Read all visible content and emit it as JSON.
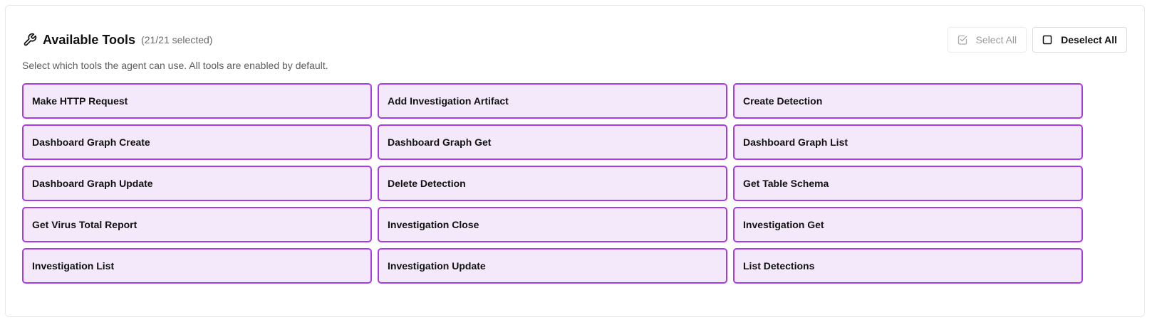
{
  "header": {
    "title": "Available Tools",
    "count": "(21/21 selected)",
    "icon": "wrench-icon"
  },
  "actions": {
    "select_all_label": "Select All",
    "deselect_all_label": "Deselect All"
  },
  "description": "Select which tools the agent can use. All tools are enabled by default.",
  "tools": [
    {
      "label": "Make HTTP Request",
      "selected": true
    },
    {
      "label": "Add Investigation Artifact",
      "selected": true
    },
    {
      "label": "Create Detection",
      "selected": true
    },
    {
      "label": "Dashboard Graph Create",
      "selected": true
    },
    {
      "label": "Dashboard Graph Get",
      "selected": true
    },
    {
      "label": "Dashboard Graph List",
      "selected": true
    },
    {
      "label": "Dashboard Graph Update",
      "selected": true
    },
    {
      "label": "Delete Detection",
      "selected": true
    },
    {
      "label": "Get Table Schema",
      "selected": true
    },
    {
      "label": "Get Virus Total Report",
      "selected": true
    },
    {
      "label": "Investigation Close",
      "selected": true
    },
    {
      "label": "Investigation Get",
      "selected": true
    },
    {
      "label": "Investigation List",
      "selected": true
    },
    {
      "label": "Investigation Update",
      "selected": true
    },
    {
      "label": "List Detections",
      "selected": true
    }
  ],
  "colors": {
    "accent": "#a83be6",
    "selected_bg": "#f4e9fb"
  }
}
